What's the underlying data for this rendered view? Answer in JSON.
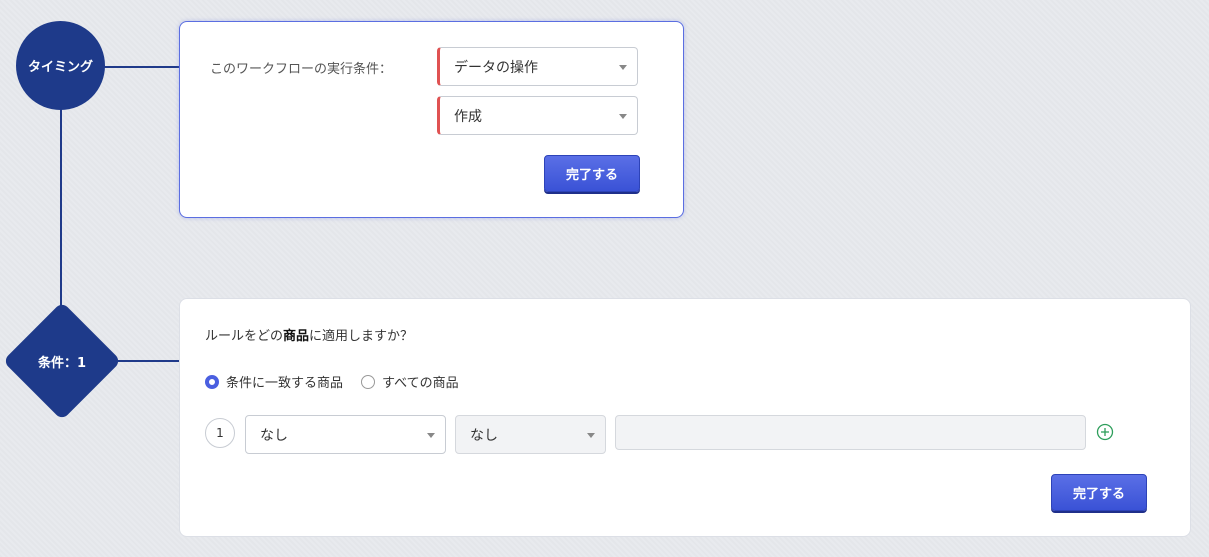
{
  "nodes": {
    "timing_label": "タイミング",
    "condition_label": "条件：1"
  },
  "timing_card": {
    "exec_label": "このワークフローの実行条件：",
    "operation_select": "データの操作",
    "create_select": "作成",
    "done_button": "完了する"
  },
  "condition_card": {
    "question_prefix": "ルールをどの",
    "question_bold": "商品",
    "question_suffix": "に適用しますか？",
    "radio_matching": "条件に一致する商品",
    "radio_all": "すべての商品",
    "selected_radio": "条件に一致する商品",
    "rule_number": "1",
    "field_select": "なし",
    "compare_select": "なし",
    "value_input": "",
    "done_button": "完了する"
  },
  "colors": {
    "node_blue": "#1e3a8a",
    "primary_button": "#3a52d6",
    "required_marker": "#e05252",
    "add_icon": "#2e9e5b"
  }
}
